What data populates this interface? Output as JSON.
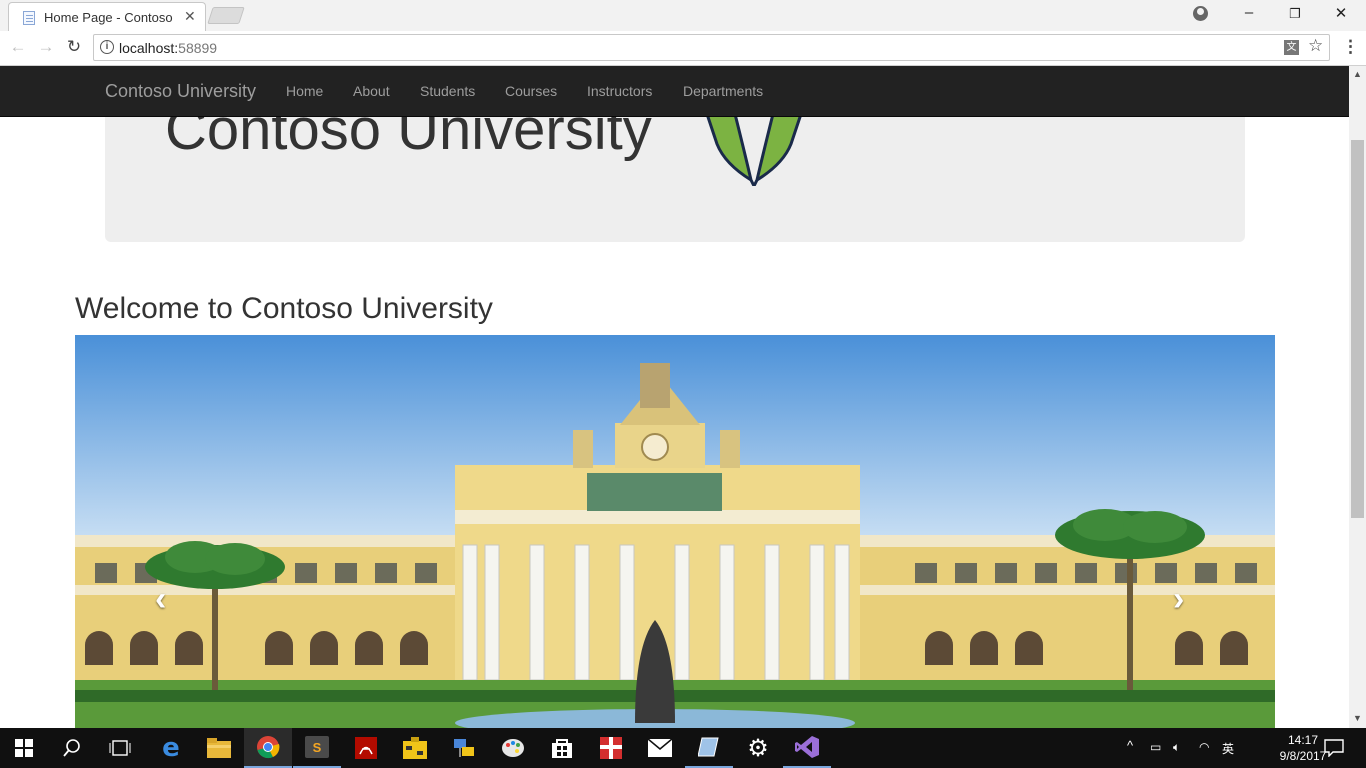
{
  "browser": {
    "tab_title": "Home Page - Contoso U",
    "tab_close": "✕",
    "url_host": "localhost:",
    "url_port": "58899",
    "window_minimize": "–",
    "window_restore": "❐",
    "window_close": "✕"
  },
  "navbar": {
    "brand": "Contoso University",
    "links": [
      "Home",
      "About",
      "Students",
      "Courses",
      "Instructors",
      "Departments"
    ]
  },
  "jumbotron": {
    "logo_text": "Contoso University"
  },
  "main": {
    "welcome_heading": "Welcome to Contoso University",
    "carousel_prev": "‹",
    "carousel_next": "›"
  },
  "taskbar": {
    "language": "英",
    "time": "14:17",
    "date": "9/8/2017",
    "apps": [
      "start-icon",
      "search-icon",
      "task-view-icon",
      "edge-icon",
      "file-explorer-icon",
      "chrome-icon",
      "sublime-icon",
      "acrobat-icon",
      "toolbox-icon",
      "network-app-icon",
      "paint-icon",
      "store-icon",
      "gift-app-icon",
      "mail-icon",
      "notes-icon",
      "settings-icon",
      "visual-studio-icon"
    ]
  }
}
